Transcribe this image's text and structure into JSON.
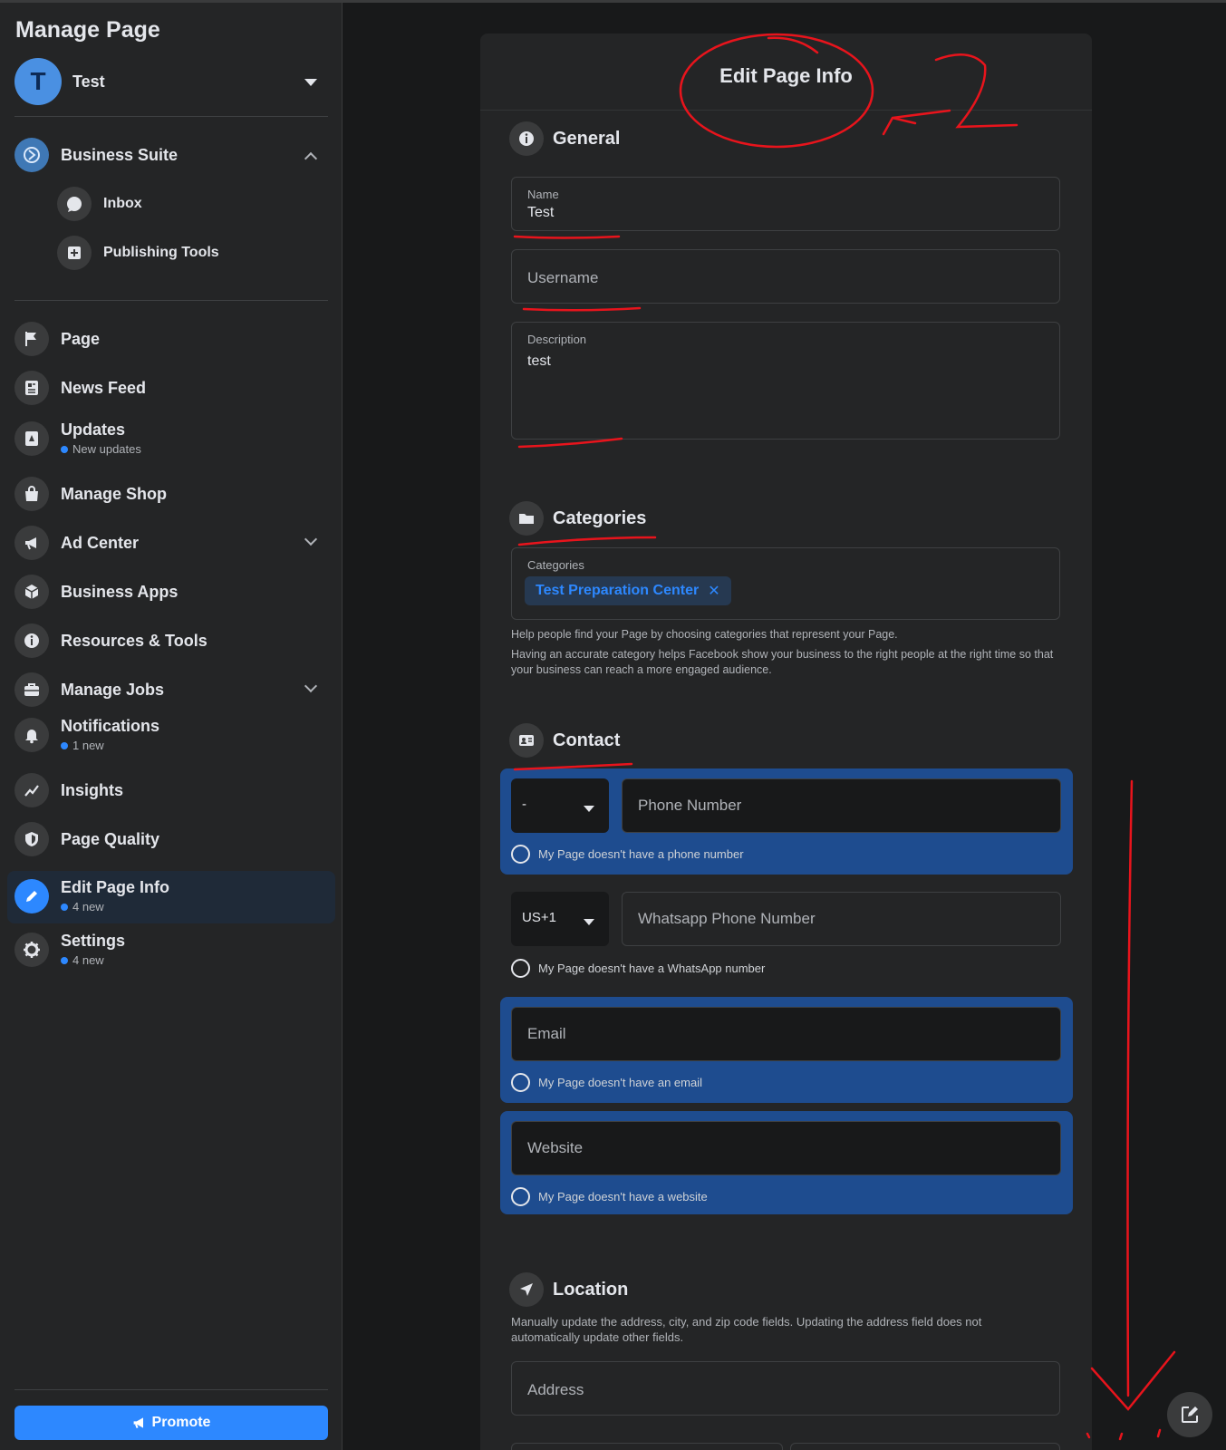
{
  "sidebar": {
    "title": "Manage Page",
    "page": {
      "initial": "T",
      "name": "Test"
    },
    "business_suite": {
      "label": "Business Suite",
      "items": [
        {
          "label": "Inbox"
        },
        {
          "label": "Publishing Tools"
        }
      ]
    },
    "items": [
      {
        "label": "Page"
      },
      {
        "label": "News Feed"
      },
      {
        "label": "Updates",
        "sub": "New updates"
      },
      {
        "label": "Manage Shop"
      },
      {
        "label": "Ad Center"
      },
      {
        "label": "Business Apps"
      },
      {
        "label": "Resources & Tools"
      },
      {
        "label": "Manage Jobs"
      },
      {
        "label": "Notifications",
        "sub": "1 new"
      },
      {
        "label": "Insights"
      },
      {
        "label": "Page Quality"
      },
      {
        "label": "Edit Page Info",
        "sub": "4 new"
      },
      {
        "label": "Settings",
        "sub": "4 new"
      }
    ],
    "promote_label": "Promote"
  },
  "main": {
    "title": "Edit Page Info",
    "general": {
      "title": "General",
      "name_label": "Name",
      "name_value": "Test",
      "username_placeholder": "Username",
      "description_label": "Description",
      "description_value": "test"
    },
    "categories": {
      "title": "Categories",
      "field_label": "Categories",
      "chip": "Test Preparation Center",
      "help1": "Help people find your Page by choosing categories that represent your Page.",
      "help2": "Having an accurate category helps Facebook show your business to the right people at the right time so that your business can reach a more engaged audience."
    },
    "contact": {
      "title": "Contact",
      "phone_code": "-",
      "phone_placeholder": "Phone Number",
      "no_phone": "My Page doesn't have a phone number",
      "wa_code": "US+1",
      "wa_placeholder": "Whatsapp Phone Number",
      "no_wa": "My Page doesn't have a WhatsApp number",
      "email_placeholder": "Email",
      "no_email": "My Page doesn't have an email",
      "website_placeholder": "Website",
      "no_website": "My Page doesn't have a website"
    },
    "location": {
      "title": "Location",
      "help": "Manually update the address, city, and zip code fields. Updating the address field does not automatically update other fields.",
      "address_placeholder": "Address"
    }
  },
  "colors": {
    "accent": "#2d88ff",
    "panel": "#242526",
    "background": "#18191a",
    "highlight": "#1e4c8f",
    "annotation": "#e8141c"
  },
  "icons": [
    "business-suite-icon",
    "chat-icon",
    "publishing-icon",
    "flag-icon",
    "news-feed-icon",
    "updates-icon",
    "shop-icon",
    "megaphone-icon",
    "cube-icon",
    "info-icon",
    "briefcase-icon",
    "bell-icon",
    "insights-icon",
    "shield-icon",
    "pencil-icon",
    "gear-icon",
    "folder-icon",
    "contact-card-icon",
    "location-arrow-icon",
    "compose-icon"
  ]
}
